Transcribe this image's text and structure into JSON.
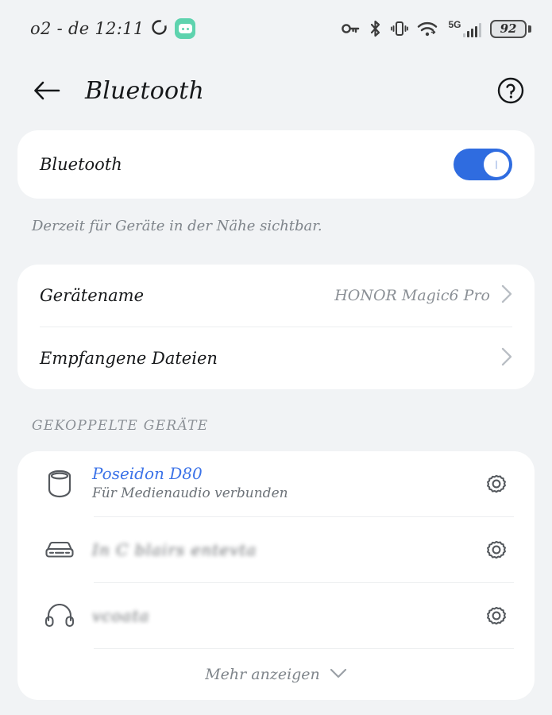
{
  "statusbar": {
    "carrier_time": "o2 - de 12:11",
    "ring_icon": "circle-outline-icon",
    "app_badge_icon": "chat-bubble-badge-icon",
    "icons": [
      "key-icon",
      "bluetooth-icon",
      "vibrate-icon",
      "wifi-icon"
    ],
    "network_label": "5G",
    "battery_level": "92"
  },
  "appbar": {
    "back_icon": "arrow-left-icon",
    "title": "Bluetooth",
    "help_icon": "question-circle-icon"
  },
  "bluetooth": {
    "label": "Bluetooth",
    "enabled": true,
    "hint": "Derzeit für Geräte in der Nähe sichtbar."
  },
  "settings_rows": [
    {
      "label": "Gerätename",
      "value": "HONOR Magic6 Pro",
      "chevron": "chevron-right-icon"
    },
    {
      "label": "Empfangene Dateien",
      "value": "",
      "chevron": "chevron-right-icon"
    }
  ],
  "paired": {
    "section_title": "GEKOPPELTE GERÄTE",
    "devices": [
      {
        "name": "Poseidon D80",
        "status": "Für Medienaudio verbunden",
        "icon": "speaker-icon",
        "gear": "gear-icon",
        "blurred": false
      },
      {
        "name": "In C blairs entevta",
        "status": "",
        "icon": "car-icon",
        "gear": "gear-icon",
        "blurred": true
      },
      {
        "name": "vcoata",
        "status": "",
        "icon": "headphones-icon",
        "gear": "gear-icon",
        "blurred": true
      }
    ],
    "more_label": "Mehr anzeigen",
    "more_icon": "chevron-down-icon"
  },
  "colors": {
    "background": "#f1f3f5",
    "card": "#ffffff",
    "accent_toggle": "#2f6ce0",
    "device_link": "#3c73e8",
    "badge_teal": "#5ed3ae"
  }
}
